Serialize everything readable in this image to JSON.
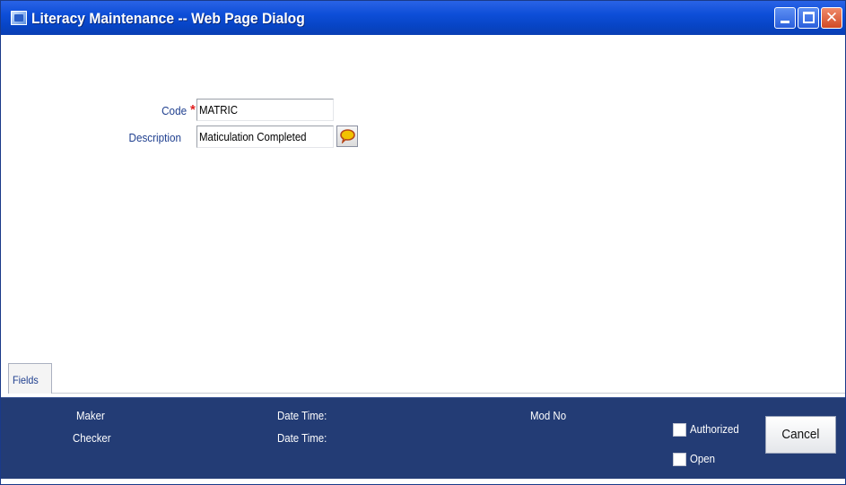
{
  "window": {
    "title": "Literacy Maintenance -- Web Page Dialog",
    "controls": {
      "minimize": "minimize",
      "maximize": "maximize",
      "close": "✕"
    }
  },
  "form": {
    "code_label": "Code",
    "code_required_marker": "*",
    "code_value": "MATRIC",
    "description_label": "Description",
    "description_value": "Maticulation Completed"
  },
  "tabs": [
    {
      "label": "Fields"
    }
  ],
  "footer": {
    "maker_label": "Maker",
    "checker_label": "Checker",
    "maker_datetime_label": "Date Time:",
    "checker_datetime_label": "Date Time:",
    "mod_no_label": "Mod No",
    "authorized_label": "Authorized",
    "authorized_checked": false,
    "open_label": "Open",
    "open_checked": false,
    "cancel_label": "Cancel"
  },
  "icons": {
    "window_icon": "web-page-dialog-icon",
    "lookup_icon": "speech-bubble-icon"
  },
  "colors": {
    "titlebar": "#0d4ed8",
    "footer": "#233c75",
    "label_text": "#1f3f8f",
    "required": "#e02020"
  }
}
